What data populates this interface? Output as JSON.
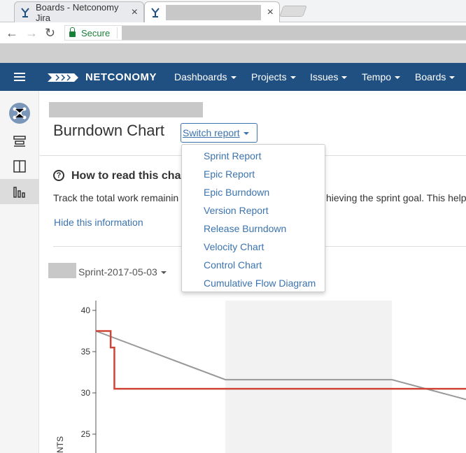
{
  "browser": {
    "tabs": [
      {
        "title": "Boards - Netconomy Jira",
        "close": "×"
      },
      {
        "title": "",
        "close": "×"
      }
    ],
    "secure_label": "Secure"
  },
  "header": {
    "brand": "NETCONOMY",
    "menu": [
      {
        "label": "Dashboards"
      },
      {
        "label": "Projects"
      },
      {
        "label": "Issues"
      },
      {
        "label": "Tempo"
      },
      {
        "label": "Boards"
      }
    ],
    "color": "#205081"
  },
  "page": {
    "title": "Burndown Chart",
    "switch_report": "Switch report",
    "help_title": "How to read this cha",
    "help_text_left": "Track the total work remainin",
    "help_text_right": "hieving the sprint goal. This help",
    "hide_info": "Hide this information",
    "sprint": "Sprint-2017-05-03"
  },
  "dropdown": {
    "items": [
      {
        "label": "Sprint Report"
      },
      {
        "label": "Epic Report"
      },
      {
        "label": "Epic Burndown"
      },
      {
        "label": "Version Report"
      },
      {
        "label": "Release Burndown"
      },
      {
        "label": "Velocity Chart"
      },
      {
        "label": "Control Chart"
      },
      {
        "label": "Cumulative Flow Diagram"
      }
    ]
  },
  "chart_data": {
    "type": "line",
    "ylabel": "NTS",
    "y_ticks": [
      25,
      30,
      35,
      40
    ],
    "ylim": [
      25,
      40
    ],
    "grid": false,
    "series": [
      {
        "color": "#999999",
        "points": [
          [
            0,
            37.5
          ],
          [
            0.35,
            31.6
          ],
          [
            0.8,
            31.6
          ],
          [
            1.0,
            29.2
          ]
        ]
      },
      {
        "color": "#d04437",
        "points": [
          [
            0,
            37.5
          ],
          [
            0.04,
            37.5
          ],
          [
            0.04,
            35.5
          ],
          [
            0.05,
            35.5
          ],
          [
            0.05,
            30.5
          ],
          [
            1.0,
            30.5
          ]
        ]
      }
    ],
    "shaded_band": [
      0.35,
      0.8
    ]
  }
}
